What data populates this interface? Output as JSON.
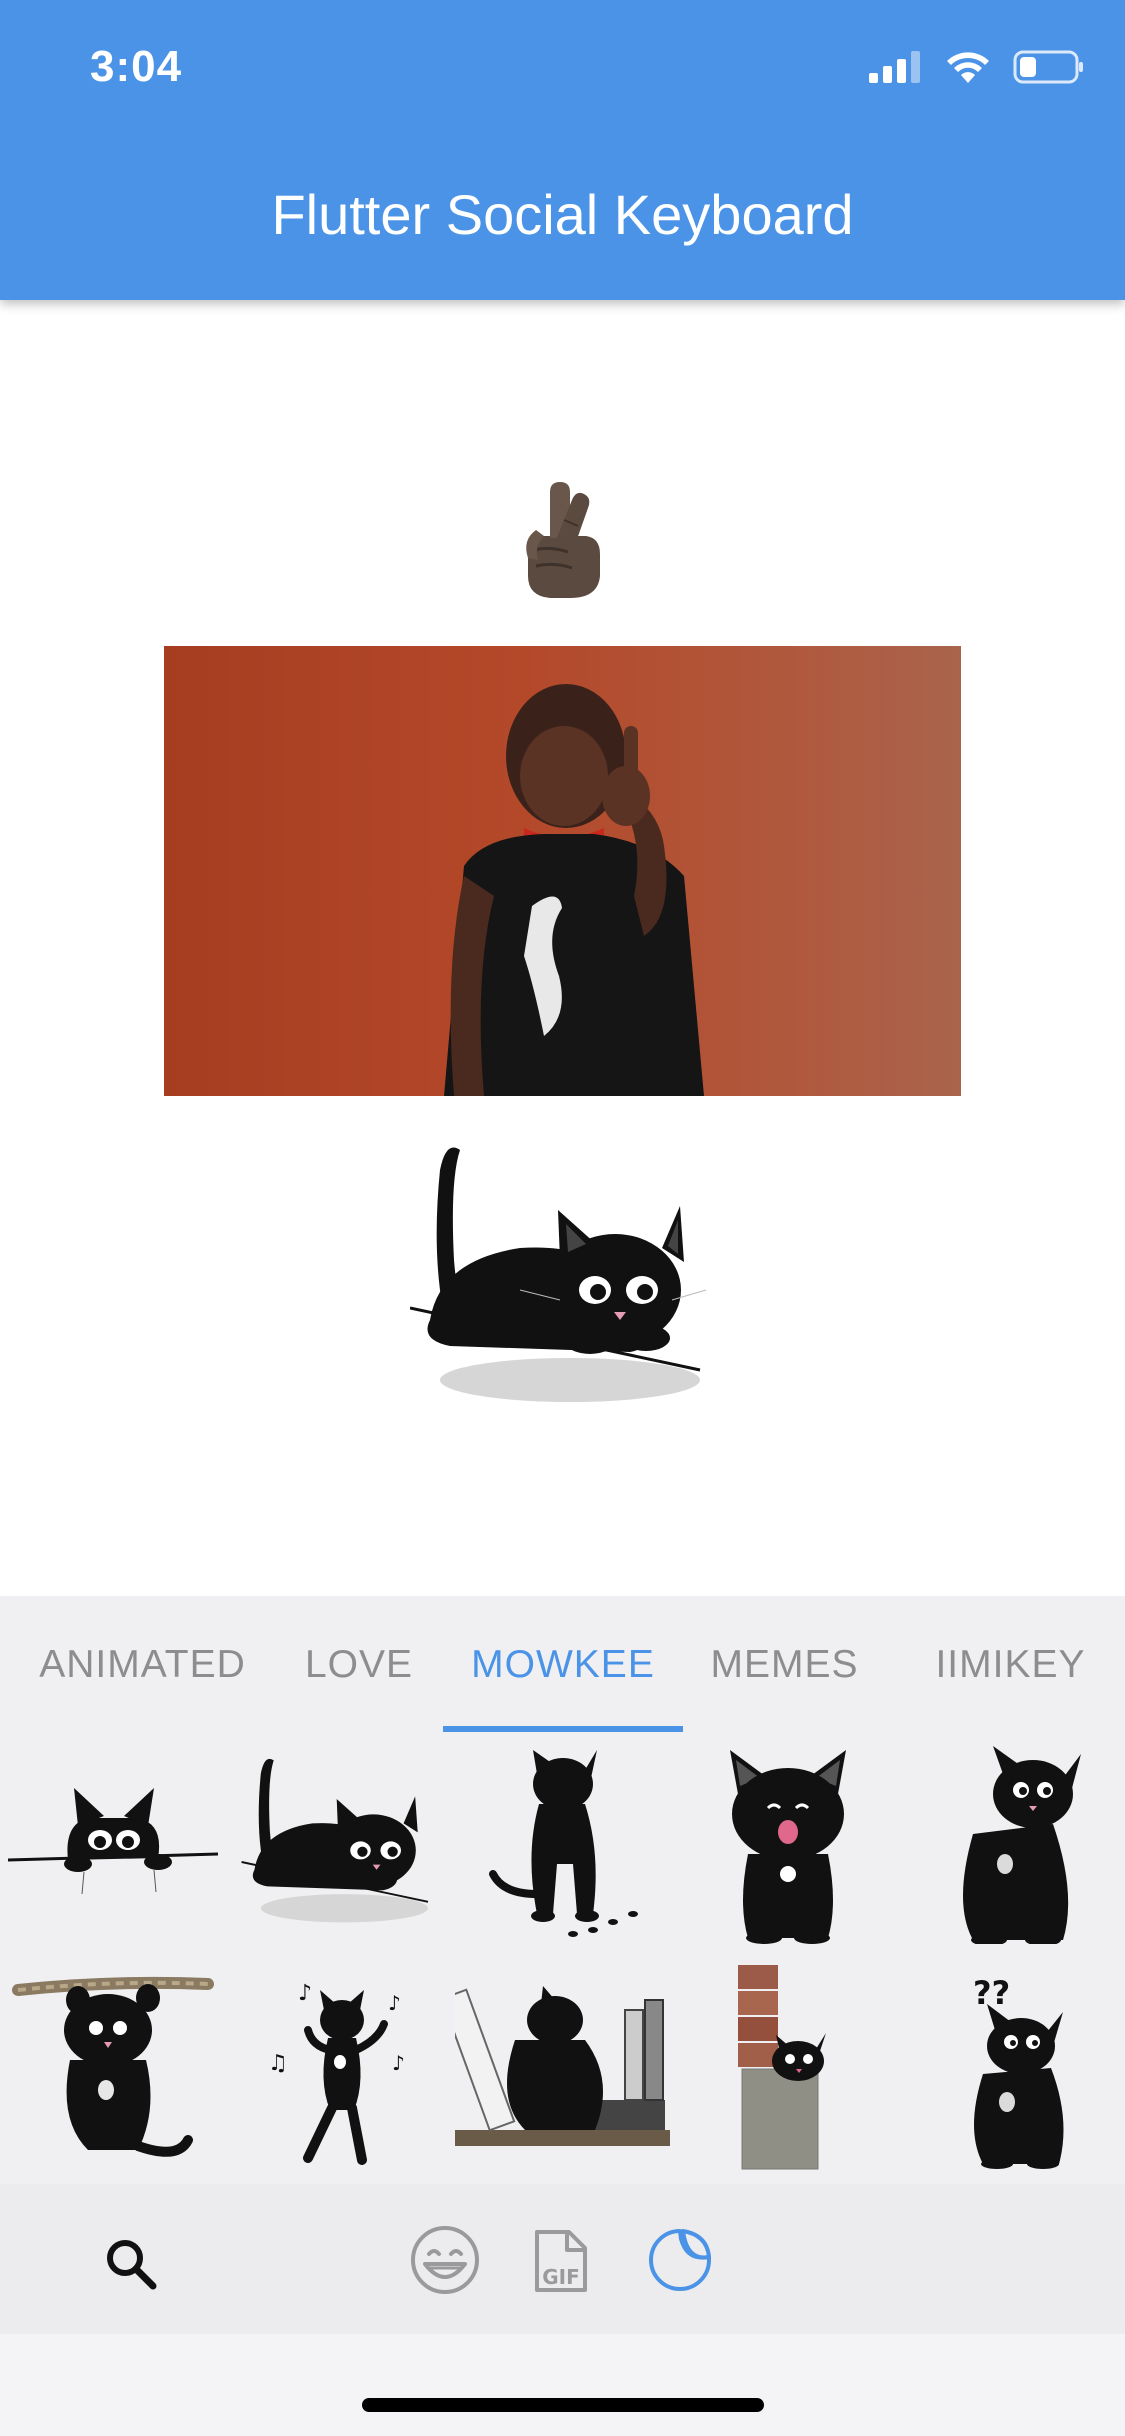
{
  "status_bar": {
    "time": "3:04"
  },
  "app_bar": {
    "title": "Flutter Social Keyboard",
    "background_color": "#4a93e7"
  },
  "messages": {
    "emoji": {
      "icon": "crossed-fingers-emoji"
    },
    "gif": {
      "icon": "person-gesturing-gif"
    },
    "sticker": {
      "icon": "black-cat-lying-sticker"
    }
  },
  "keyboard": {
    "tabs": [
      {
        "label": "ANIMATED"
      },
      {
        "label": "LOVE"
      },
      {
        "label": "MOWKEE"
      },
      {
        "label": "MEMES"
      },
      {
        "label": "IIMIKEY"
      }
    ],
    "active_tab": "MOWKEE",
    "accent_color": "#4a93e7",
    "stickers": [
      {
        "icon": "cat-peeking-over-ledge-sticker"
      },
      {
        "icon": "cat-lying-sticker"
      },
      {
        "icon": "cat-standing-paw-prints-sticker"
      },
      {
        "icon": "cat-meowing-sticker"
      },
      {
        "icon": "cat-sitting-looking-back-sticker"
      },
      {
        "icon": "cat-hanging-on-rope-sticker"
      },
      {
        "icon": "cat-dancing-music-sticker"
      },
      {
        "icon": "cat-books-sticker"
      },
      {
        "icon": "cat-behind-wall-sticker"
      },
      {
        "icon": "cat-confused-question-sticker"
      }
    ],
    "bottom_bar": {
      "search": {
        "icon": "search-icon"
      },
      "emoji": {
        "icon": "smiley-icon"
      },
      "gif": {
        "icon": "gif-file-icon",
        "label": "GIF"
      },
      "sticker": {
        "icon": "sticker-icon",
        "active": true
      }
    }
  }
}
